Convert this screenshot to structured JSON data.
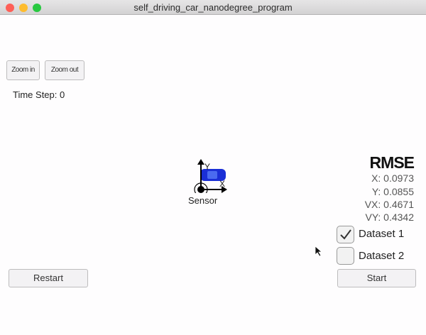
{
  "window": {
    "title": "self_driving_car_nanodegree_program"
  },
  "toolbar": {
    "zoom_in": "Zoom in",
    "zoom_out": "Zoom out"
  },
  "status": {
    "time_step": "Time Step: 0"
  },
  "scene": {
    "axis_x": "X",
    "axis_y": "Y",
    "sensor_label": "Sensor",
    "car_color": "#1a2fd6"
  },
  "rmse": {
    "title": "RMSE",
    "x": "X: 0.0973",
    "y": "Y: 0.0855",
    "vx": "VX: 0.4671",
    "vy": "VY: 0.4342"
  },
  "datasets": [
    {
      "label": "Dataset 1",
      "checked": true
    },
    {
      "label": "Dataset 2",
      "checked": false
    }
  ],
  "controls": {
    "restart": "Restart",
    "start": "Start"
  }
}
